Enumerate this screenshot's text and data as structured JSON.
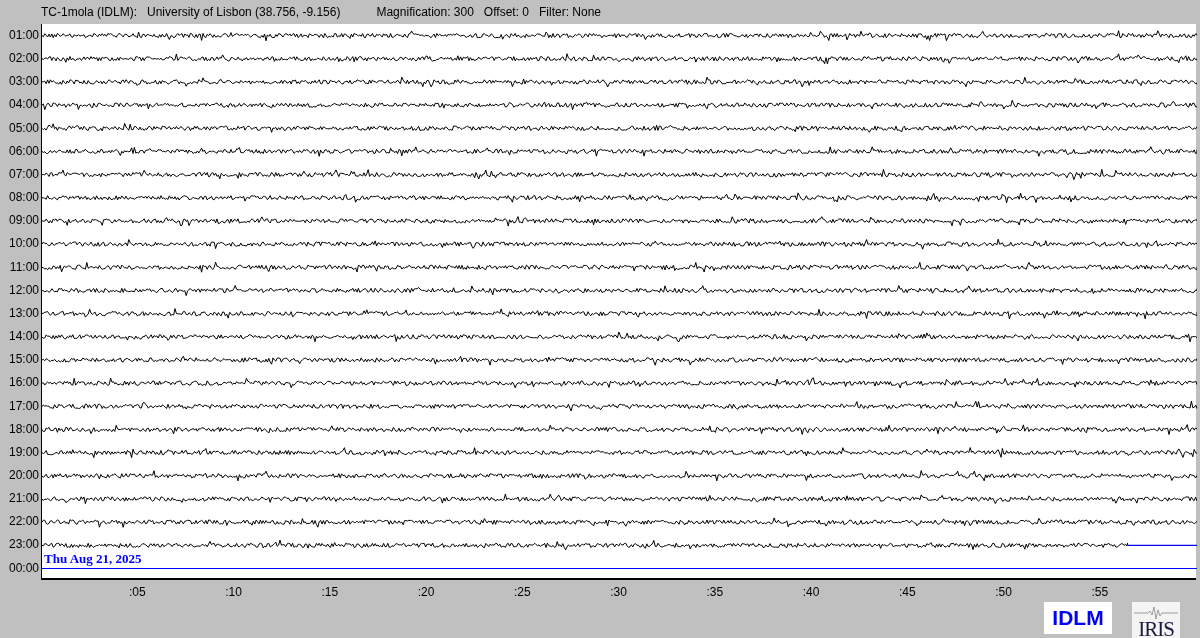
{
  "header": {
    "station": "TC-1mola (IDLM):",
    "location": "University of Lisbon (38.756, -9.156)",
    "magnification": "Magnification: 300",
    "offset": "Offset: 0",
    "filter": "Filter: None"
  },
  "helicorder": {
    "rows": [
      {
        "label": "01:00",
        "kind": "trace"
      },
      {
        "label": "02:00",
        "kind": "trace"
      },
      {
        "label": "03:00",
        "kind": "trace"
      },
      {
        "label": "04:00",
        "kind": "trace"
      },
      {
        "label": "05:00",
        "kind": "trace"
      },
      {
        "label": "06:00",
        "kind": "trace"
      },
      {
        "label": "07:00",
        "kind": "trace"
      },
      {
        "label": "08:00",
        "kind": "trace"
      },
      {
        "label": "09:00",
        "kind": "trace"
      },
      {
        "label": "10:00",
        "kind": "trace"
      },
      {
        "label": "11:00",
        "kind": "trace"
      },
      {
        "label": "12:00",
        "kind": "trace"
      },
      {
        "label": "13:00",
        "kind": "trace"
      },
      {
        "label": "14:00",
        "kind": "trace"
      },
      {
        "label": "15:00",
        "kind": "trace"
      },
      {
        "label": "16:00",
        "kind": "trace"
      },
      {
        "label": "17:00",
        "kind": "trace"
      },
      {
        "label": "18:00",
        "kind": "trace"
      },
      {
        "label": "19:00",
        "kind": "trace"
      },
      {
        "label": "20:00",
        "kind": "trace"
      },
      {
        "label": "21:00",
        "kind": "trace"
      },
      {
        "label": "22:00",
        "kind": "trace"
      },
      {
        "label": "23:00",
        "kind": "partial",
        "level": 0.94
      },
      {
        "label": "00:00",
        "kind": "empty"
      }
    ],
    "date_label": "Thu Aug 21, 2025",
    "x_ticks": [
      ":05",
      ":10",
      ":15",
      ":20",
      ":25",
      ":30",
      ":35",
      ":40",
      ":45",
      ":50",
      ":55"
    ]
  },
  "logos": [
    {
      "text": "IDLM",
      "kind": "box"
    },
    {
      "text": "IRIS",
      "kind": "seismo"
    }
  ]
}
